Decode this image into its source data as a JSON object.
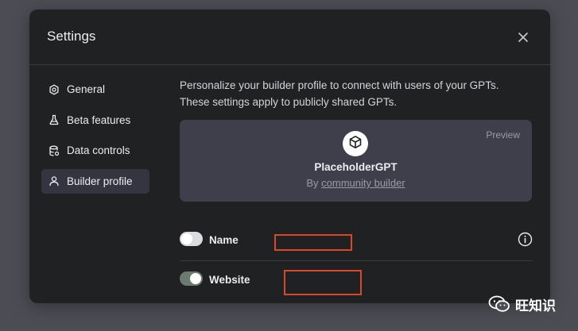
{
  "dialog": {
    "title": "Settings"
  },
  "sidebar": {
    "items": [
      {
        "label": "General",
        "icon": "gear-icon",
        "active": false
      },
      {
        "label": "Beta features",
        "icon": "flask-icon",
        "active": false
      },
      {
        "label": "Data controls",
        "icon": "database-icon",
        "active": false
      },
      {
        "label": "Builder profile",
        "icon": "user-icon",
        "active": true
      }
    ]
  },
  "builder_profile": {
    "intro": "Personalize your builder profile to connect with users of your GPTs. These settings apply to publicly shared GPTs.",
    "preview": {
      "label": "Preview",
      "gpt_name": "PlaceholderGPT",
      "by_prefix": "By",
      "author": "community builder"
    },
    "name_row": {
      "label": "Name",
      "enabled": false
    },
    "website_row": {
      "label": "Website",
      "enabled": true
    }
  },
  "colors": {
    "dialog_bg": "#202123",
    "card_bg": "#3e3f4b",
    "highlight_box": "#d9482b",
    "toggle_on": "#6b7b70"
  },
  "watermark": {
    "text": "旺知识"
  }
}
